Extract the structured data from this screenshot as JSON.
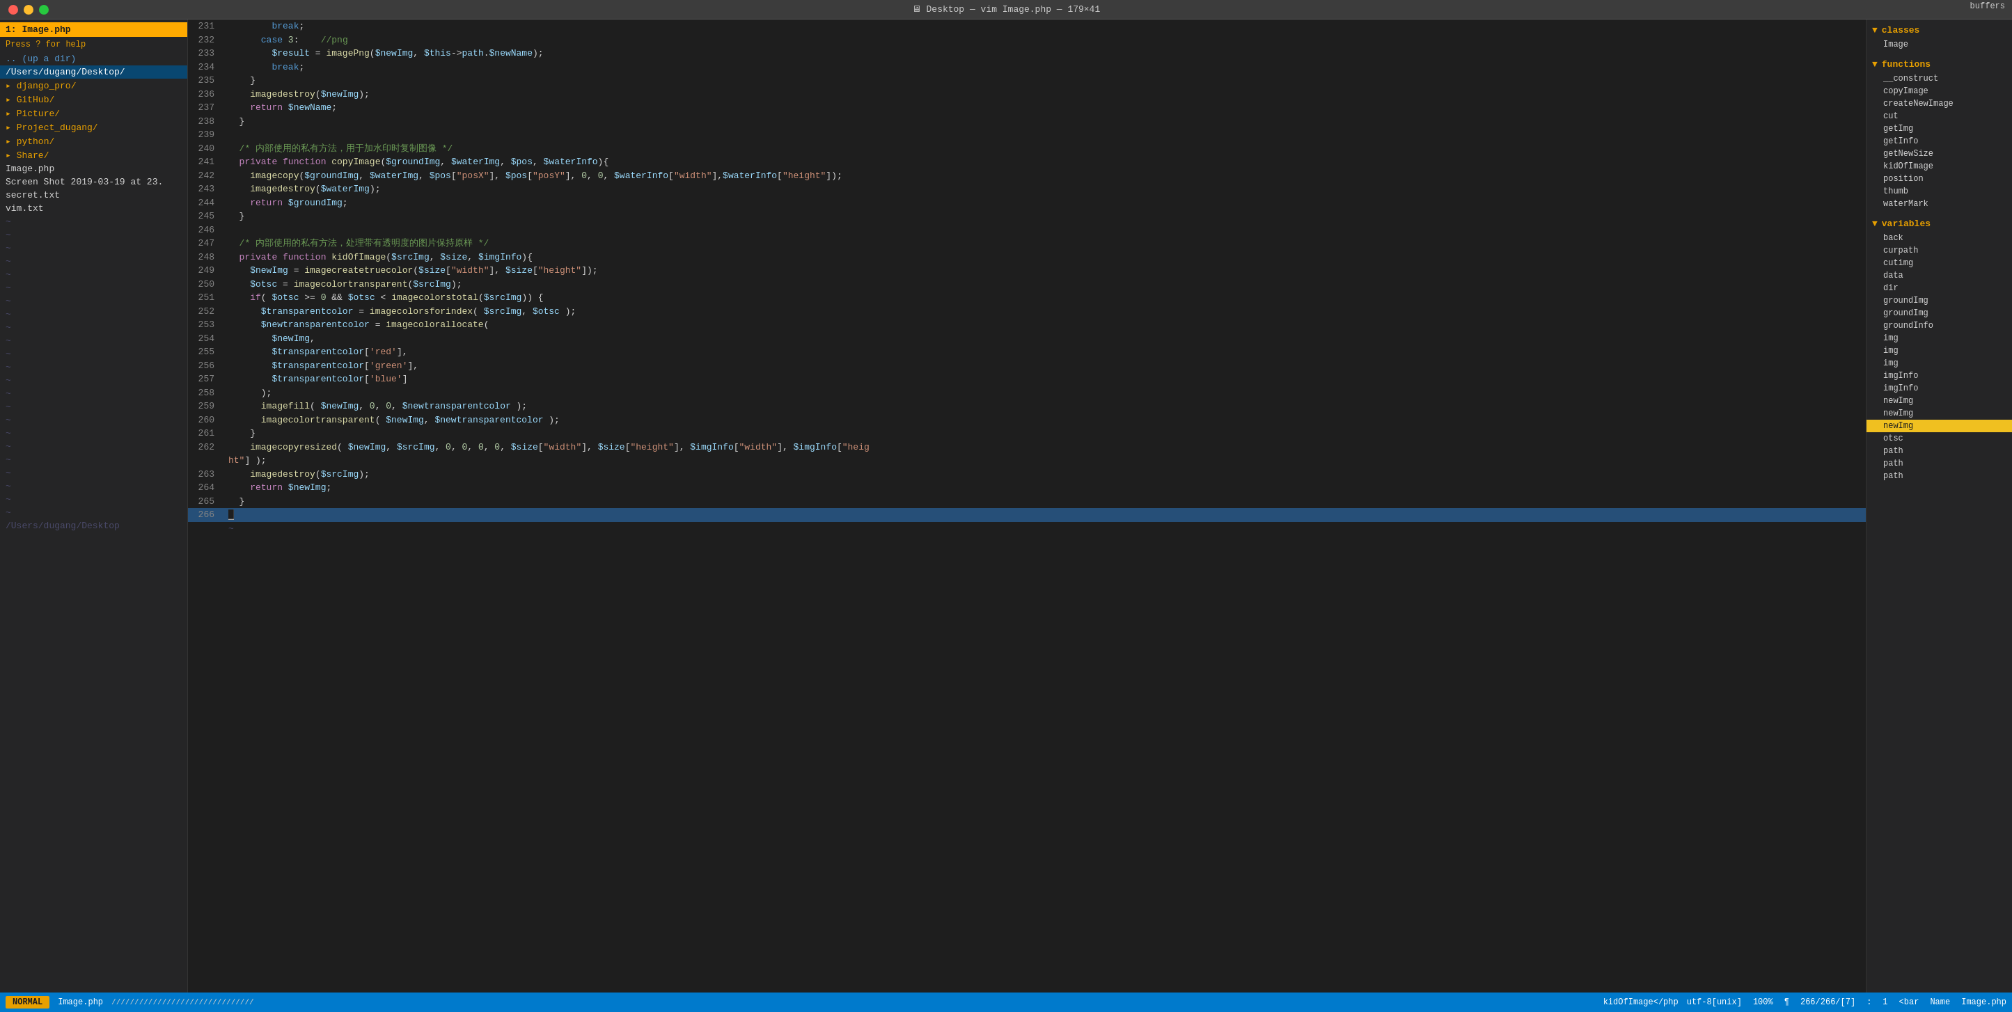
{
  "titlebar": {
    "text": "🖥 Desktop — vim Image.php — 179×41"
  },
  "sidebar": {
    "header": "1: Image.php",
    "help": " Press ? for help",
    "items": [
      {
        "label": ".. (up a dir)",
        "type": "updir"
      },
      {
        "label": "/Users/dugang/Desktop/",
        "type": "active"
      },
      {
        "label": "django_pro/",
        "type": "dir"
      },
      {
        "label": "GitHub/",
        "type": "dir"
      },
      {
        "label": "Picture/",
        "type": "dir"
      },
      {
        "label": "Project_dugang/",
        "type": "dir"
      },
      {
        "label": "python/",
        "type": "dir"
      },
      {
        "label": "Share/",
        "type": "dir"
      },
      {
        "label": "Image.php",
        "type": "file"
      },
      {
        "label": "Screen Shot 2019-03-19 at 23.",
        "type": "file"
      },
      {
        "label": "secret.txt",
        "type": "file"
      },
      {
        "label": "vim.txt",
        "type": "file"
      }
    ]
  },
  "right_panel": {
    "sections": [
      {
        "name": "classes",
        "label": "classes",
        "items": [
          "Image"
        ]
      },
      {
        "name": "functions",
        "label": "functions",
        "items": [
          "__construct",
          "copyImage",
          "createNewImage",
          "cut",
          "getImg",
          "getInfo",
          "getNewSize",
          "kidOfImage",
          "position",
          "thumb",
          "waterMark"
        ]
      },
      {
        "name": "variables",
        "label": "variables",
        "items": [
          "back",
          "curpath",
          "cutimg",
          "data",
          "dir",
          "groundImg",
          "groundImg",
          "groundInfo",
          "img",
          "img",
          "img",
          "imgInfo",
          "imgInfo",
          "newImg",
          "newImg",
          "newImg(highlighted)",
          "otsc",
          "path",
          "path",
          "path"
        ]
      }
    ]
  },
  "buffers_btn": "buffers",
  "code_lines": [
    {
      "num": 231,
      "content": "        break;"
    },
    {
      "num": 232,
      "content": "      case 3:    //png"
    },
    {
      "num": 233,
      "content": "        $result = imagePng($newImg, $this->path.$newName);"
    },
    {
      "num": 234,
      "content": "        break;"
    },
    {
      "num": 235,
      "content": "    }"
    },
    {
      "num": 236,
      "content": "    imagedestroy($newImg);"
    },
    {
      "num": 237,
      "content": "    return $newName;"
    },
    {
      "num": 238,
      "content": "  }"
    },
    {
      "num": 239,
      "content": ""
    },
    {
      "num": 240,
      "content": "  /* 内部使用的私有方法，用于加水印时复制图像 */"
    },
    {
      "num": 241,
      "content": "  private function copyImage($groundImg, $waterImg, $pos, $waterInfo){"
    },
    {
      "num": 242,
      "content": "    imagecopy($groundImg, $waterImg, $pos[\"posX\"], $pos[\"posY\"], 0, 0, $waterInfo[\"width\"],$waterInfo[\"height\"]);"
    },
    {
      "num": 243,
      "content": "    imagedestroy($waterImg);"
    },
    {
      "num": 244,
      "content": "    return $groundImg;"
    },
    {
      "num": 245,
      "content": "  }"
    },
    {
      "num": 246,
      "content": ""
    },
    {
      "num": 247,
      "content": "  /* 内部使用的私有方法，处理带有透明度的图片保持原样 */"
    },
    {
      "num": 248,
      "content": "  private function kidOfImage($srcImg, $size, $imgInfo){"
    },
    {
      "num": 249,
      "content": "    $newImg = imagecreatetruecolor($size[\"width\"], $size[\"height\"]);"
    },
    {
      "num": 250,
      "content": "    $otsc = imagecolortransparent($srcImg);"
    },
    {
      "num": 251,
      "content": "    if( $otsc >= 0 && $otsc < imagecolorstotal($srcImg)) {"
    },
    {
      "num": 252,
      "content": "      $transparentcolor = imagecolorsforindex( $srcImg, $otsc );"
    },
    {
      "num": 253,
      "content": "      $newtransparentcolor = imagecolorallocate("
    },
    {
      "num": 254,
      "content": "        $newImg,"
    },
    {
      "num": 255,
      "content": "        $transparentcolor['red'],"
    },
    {
      "num": 256,
      "content": "        $transparentcolor['green'],"
    },
    {
      "num": 257,
      "content": "        $transparentcolor['blue']"
    },
    {
      "num": 258,
      "content": "      );"
    },
    {
      "num": 259,
      "content": "      imagefill( $newImg, 0, 0, $newtransparentcolor );"
    },
    {
      "num": 260,
      "content": "      imagecolortransparent( $newImg, $newtransparentcolor );"
    },
    {
      "num": 261,
      "content": "    }"
    },
    {
      "num": 262,
      "content": "    imagecopyresized( $newImg, $srcImg, 0, 0, 0, 0, $size[\"width\"], $size[\"height\"], $imgInfo[\"width\"], $imgInfo[\"heig"
    },
    {
      "num": 263,
      "content": "ht\"] );"
    },
    {
      "num": 263,
      "content": "    imagedestroy($srcImg);"
    },
    {
      "num": 264,
      "content": "    return $newImg;"
    },
    {
      "num": 265,
      "content": "  }"
    },
    {
      "num": 266,
      "content": "█",
      "is_cursor": true
    }
  ],
  "statusbar": {
    "mode": "NORMAL",
    "filename": "Image.php",
    "slashes": "///////////////////////////////////////////////",
    "func": "kidOfImage</php",
    "encoding": "utf-8[unix]",
    "percent": "100%",
    "position": "266/266/[7]",
    "col": "1",
    "bar": "<bar",
    "name": "Name",
    "right_filename": "Image.php"
  },
  "footer": {
    "path": "/Users/dugang/Desktop"
  }
}
